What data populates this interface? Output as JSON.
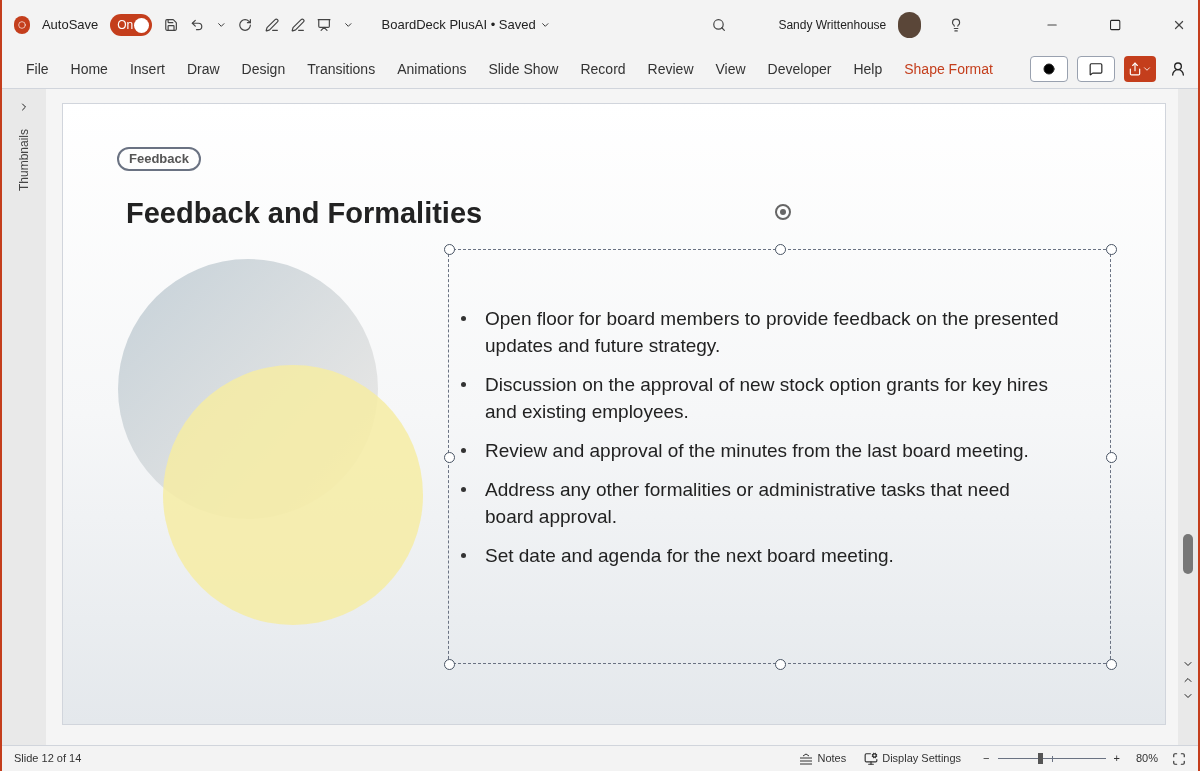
{
  "title_bar": {
    "autosave_label": "AutoSave",
    "autosave": {
      "on": true,
      "label": "On"
    },
    "document_title": "BoardDeck PlusAI • Saved",
    "user_name": "Sandy Writtenhouse"
  },
  "ribbon_tabs": [
    {
      "label": "File",
      "selected": false
    },
    {
      "label": "Home",
      "selected": false
    },
    {
      "label": "Insert",
      "selected": false
    },
    {
      "label": "Draw",
      "selected": false
    },
    {
      "label": "Design",
      "selected": false
    },
    {
      "label": "Transitions",
      "selected": false
    },
    {
      "label": "Animations",
      "selected": false
    },
    {
      "label": "Slide Show",
      "selected": false
    },
    {
      "label": "Record",
      "selected": false
    },
    {
      "label": "Review",
      "selected": false
    },
    {
      "label": "View",
      "selected": false
    },
    {
      "label": "Developer",
      "selected": false
    },
    {
      "label": "Help",
      "selected": false
    },
    {
      "label": "Shape Format",
      "selected": true
    }
  ],
  "thumbnails_panel": {
    "label": "Thumbnails"
  },
  "slide": {
    "tag": "Feedback",
    "title": "Feedback and Formalities",
    "bullets": [
      "Open floor for board members to provide feedback on the presented updates and future strategy.",
      "Discussion on the approval of new stock option grants for key hires and existing employees.",
      "Review and approval of the minutes from the last board meeting.",
      "Address any other formalities or administrative tasks that need board approval.",
      "Set date and agenda for the next board meeting."
    ]
  },
  "status_bar": {
    "slide_counter": "Slide 12 of 14",
    "notes": "Notes",
    "display_settings": "Display Settings",
    "zoom_out": "−",
    "zoom_in": "+",
    "zoom": {
      "level": 0.39
    },
    "zoom_reading": "80%"
  }
}
